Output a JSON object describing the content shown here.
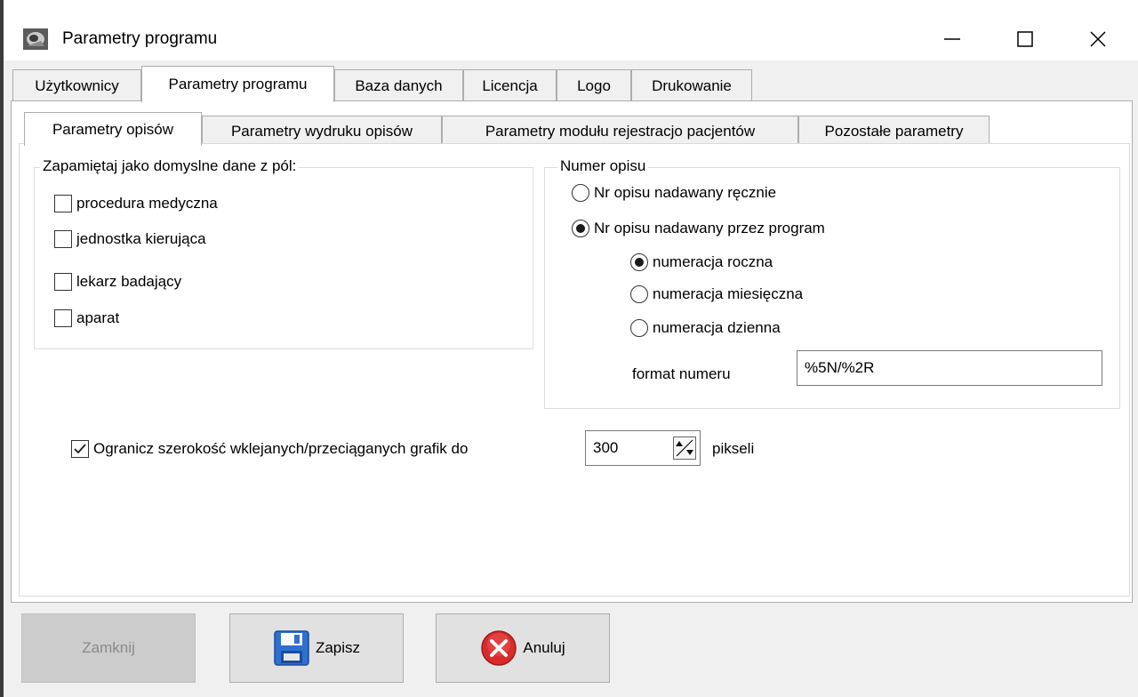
{
  "window": {
    "title": "Parametry programu"
  },
  "main_tabs": [
    {
      "label": "Użytkownicy",
      "active": false
    },
    {
      "label": "Parametry programu",
      "active": true
    },
    {
      "label": "Baza danych",
      "active": false
    },
    {
      "label": "Licencja",
      "active": false
    },
    {
      "label": "Logo",
      "active": false
    },
    {
      "label": "Drukowanie",
      "active": false
    }
  ],
  "sub_tabs": [
    {
      "label": "Parametry opisów",
      "active": true
    },
    {
      "label": "Parametry wydruku opisów",
      "active": false
    },
    {
      "label": "Parametry modułu rejestracjo pacjentów",
      "active": false
    },
    {
      "label": "Pozostałe parametry",
      "active": false
    }
  ],
  "defaults_group": {
    "title": "Zapamiętaj jako domyslne dane z pól:",
    "items": [
      {
        "label": "procedura medyczna",
        "checked": false
      },
      {
        "label": "jednostka kierująca",
        "checked": false
      },
      {
        "label": "lekarz badający",
        "checked": false
      },
      {
        "label": "aparat",
        "checked": false
      }
    ]
  },
  "numer_group": {
    "title": "Numer opisu",
    "mode_options": [
      {
        "label": "Nr opisu nadawany ręcznie",
        "selected": false
      },
      {
        "label": "Nr opisu nadawany przez program",
        "selected": true
      }
    ],
    "numbering_options": [
      {
        "label": "numeracja roczna",
        "selected": true
      },
      {
        "label": "numeracja miesięczna",
        "selected": false
      },
      {
        "label": "numeracja dzienna",
        "selected": false
      }
    ],
    "format_label": "format numeru",
    "format_value": "%5N/%2R"
  },
  "image_limit": {
    "checked": true,
    "label": "Ogranicz szerokość wklejanych/przeciąganych grafik do",
    "value": "300",
    "unit": "pikseli"
  },
  "buttons": {
    "close": "Zamknij",
    "save": "Zapisz",
    "cancel": "Anuluj"
  },
  "colors": {
    "save_icon": "#2f6fcf",
    "cancel_icon": "#d92b2b"
  }
}
